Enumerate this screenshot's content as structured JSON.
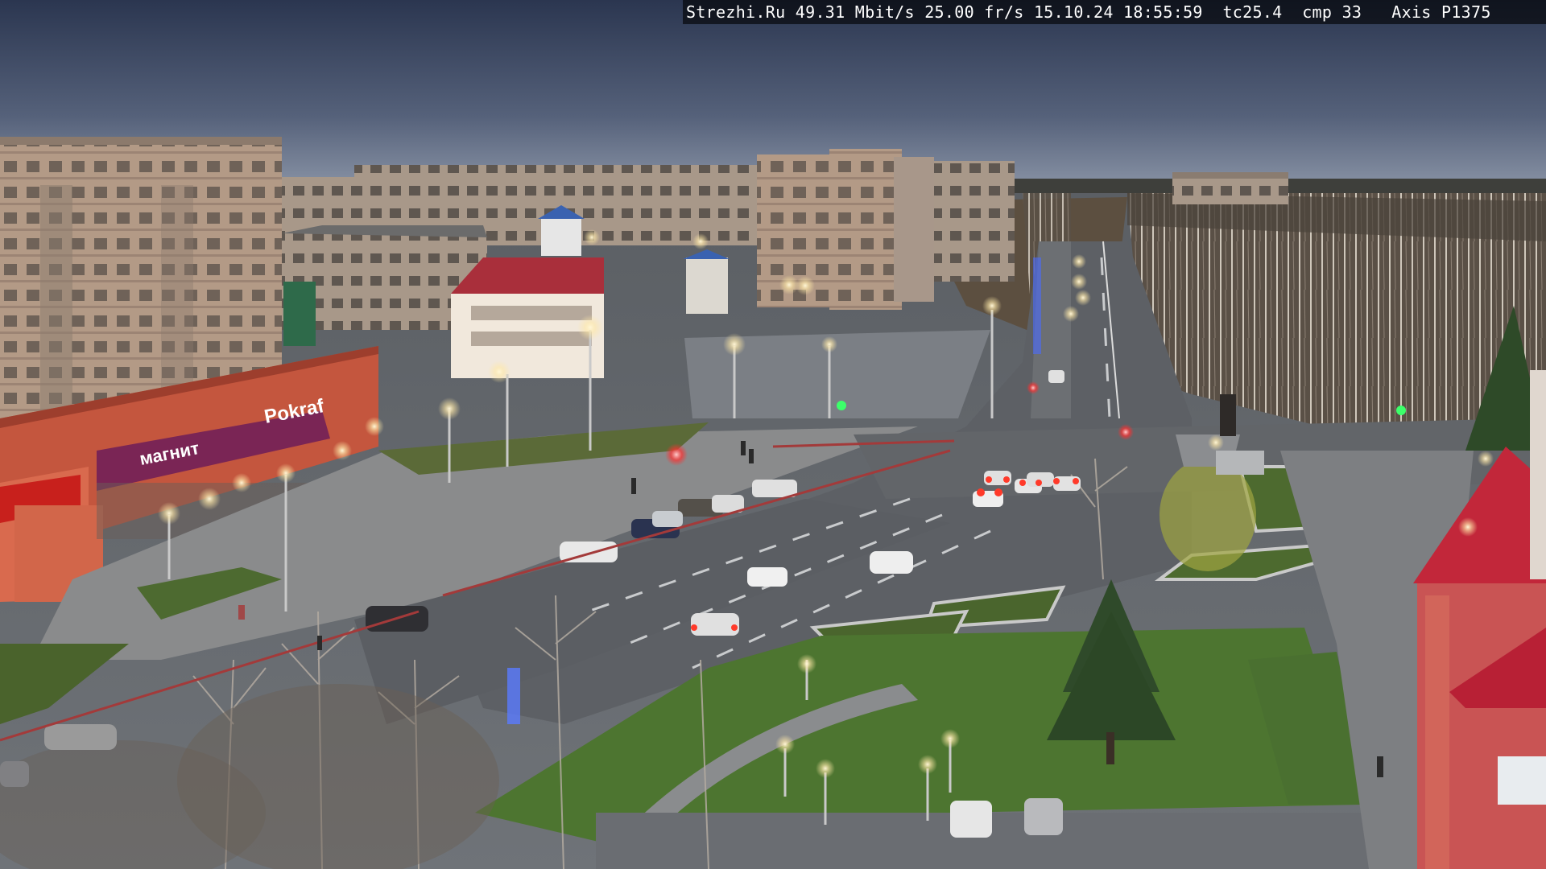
{
  "overlay": {
    "site": "Strezhi.Ru",
    "bitrate": "49.31 Mbit/s",
    "framerate": "25.00 fr/s",
    "datetime": "15.10.24 18:55:59",
    "tc": "tc25.4",
    "cmp": "cmp 33",
    "camera": "Axis P1375"
  },
  "storefront": {
    "sign_left": "магнит",
    "sign_right": "Pokraf"
  },
  "palette": {
    "sky_top": "#2d3a52",
    "sky_bottom": "#8a95a8",
    "asphalt": "#6a6e74",
    "grass": "#4a6a2c",
    "brick": "#c9553a",
    "tower": "#d05050"
  }
}
